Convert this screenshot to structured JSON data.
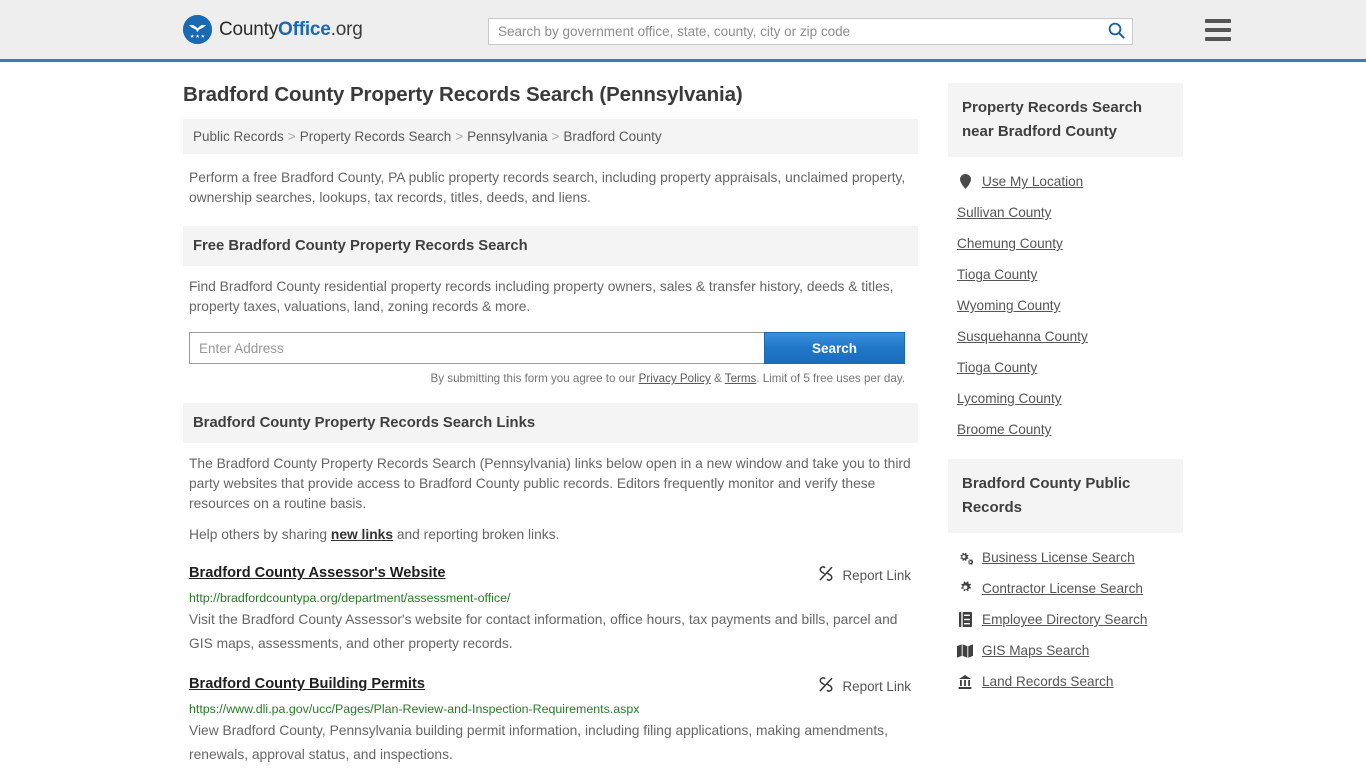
{
  "header": {
    "brand": {
      "part1": "County",
      "part2": "Office",
      "part3": ".org"
    },
    "search_placeholder": "Search by government office, state, county, city or zip code",
    "search_value": "",
    "search_icon": "search-icon",
    "menu_icon": "hamburger-menu-icon"
  },
  "page": {
    "title": "Bradford County Property Records Search (Pennsylvania)",
    "breadcrumb": [
      "Public Records",
      "Property Records Search",
      "Pennsylvania",
      "Bradford County"
    ],
    "breadcrumb_separator": ">",
    "lede": "Perform a free Bradford County, PA public property records search, including property appraisals, unclaimed property, ownership searches, lookups, tax records, titles, deeds, and liens."
  },
  "free_search": {
    "heading": "Free Bradford County Property Records Search",
    "description": "Find Bradford County residential property records including property owners, sales & transfer history, deeds & titles, property taxes, valuations, land, zoning records & more.",
    "input_placeholder": "Enter Address",
    "input_value": "",
    "button_label": "Search",
    "disclaimer_pre": "By submitting this form you agree to our ",
    "disclaimer_privacy": "Privacy Policy",
    "disclaimer_amp": " & ",
    "disclaimer_terms": "Terms",
    "disclaimer_post": ". Limit of 5 free uses per day."
  },
  "links_section": {
    "heading": "Bradford County Property Records Search Links",
    "paragraph": "The Bradford County Property Records Search (Pennsylvania) links below open in a new window and take you to third party websites that provide access to Bradford County public records. Editors frequently monitor and verify these resources on a routine basis.",
    "help_pre": "Help others by sharing ",
    "help_link": "new links",
    "help_post": " and reporting broken links.",
    "report_label": "Report Link",
    "report_icon": "broken-link-icon",
    "results": [
      {
        "title": "Bradford County Assessor's Website",
        "url": "http://bradfordcountypa.org/department/assessment-office/",
        "description": "Visit the Bradford County Assessor's website for contact information, office hours, tax payments and bills, parcel and GIS maps, assessments, and other property records."
      },
      {
        "title": "Bradford County Building Permits",
        "url": "https://www.dli.pa.gov/ucc/Pages/Plan-Review-and-Inspection-Requirements.aspx",
        "description": "View Bradford County, Pennsylvania building permit information, including filing applications, making amendments, renewals, approval status, and inspections."
      }
    ]
  },
  "sidebar": {
    "nearby_panel": {
      "heading": "Property Records Search near Bradford County",
      "items": [
        {
          "label": "Use My Location",
          "icon": "map-pin-icon"
        },
        {
          "label": "Sullivan County",
          "icon": ""
        },
        {
          "label": "Chemung County",
          "icon": ""
        },
        {
          "label": "Tioga County",
          "icon": ""
        },
        {
          "label": "Wyoming County",
          "icon": ""
        },
        {
          "label": "Susquehanna County",
          "icon": ""
        },
        {
          "label": "Tioga County",
          "icon": ""
        },
        {
          "label": "Lycoming County",
          "icon": ""
        },
        {
          "label": "Broome County",
          "icon": ""
        }
      ]
    },
    "public_records_panel": {
      "heading": "Bradford County Public Records",
      "items": [
        {
          "label": "Business License Search",
          "icon": "cogs-icon"
        },
        {
          "label": "Contractor License Search",
          "icon": "cog-icon"
        },
        {
          "label": "Employee Directory Search",
          "icon": "id-card-icon"
        },
        {
          "label": "GIS Maps Search",
          "icon": "map-icon"
        },
        {
          "label": "Land Records Search",
          "icon": "landmark-icon"
        }
      ]
    }
  },
  "colors": {
    "brand_blue": "#1a69b4",
    "header_border": "#3c7cb4",
    "header_bg": "#eeeeee",
    "panel_bg": "#f4f4f4",
    "button_blue": "#2077c8",
    "url_green": "#2a7a2a"
  }
}
